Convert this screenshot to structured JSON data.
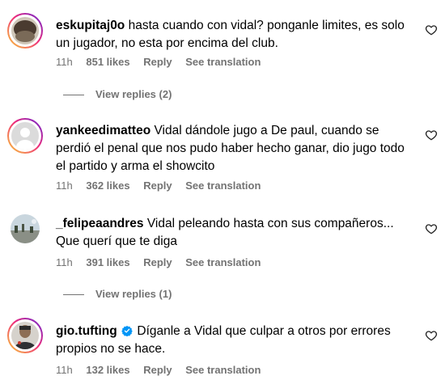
{
  "comments": [
    {
      "username": "eskupitaj0o",
      "text": "hasta cuando con vidal? ponganle limites, es solo un jugador, no esta por encima del club.",
      "time": "11h",
      "likes": "851 likes",
      "reply": "Reply",
      "translation": "See translation",
      "view_replies": "View replies (2)"
    },
    {
      "username": "yankeedimatteo",
      "text": "Vidal dándole jugo a De paul, cuando se perdió el penal que nos pudo haber hecho ganar, dio jugo todo el partido y arma el showcito",
      "time": "11h",
      "likes": "362 likes",
      "reply": "Reply",
      "translation": "See translation"
    },
    {
      "username": "_felipeaandres",
      "text": "Vidal peleando hasta con sus compañeros... Que querí que te diga",
      "time": "11h",
      "likes": "391 likes",
      "reply": "Reply",
      "translation": "See translation",
      "view_replies": "View replies (1)"
    },
    {
      "username": "gio.tufting",
      "text": "Díganle a Vidal que culpar a otros por errores propios no se hace.",
      "time": "11h",
      "likes": "132 likes",
      "reply": "Reply",
      "translation": "See translation"
    }
  ],
  "icons": {
    "like": "heart-outline-icon",
    "verified": "verified-badge-icon"
  },
  "colors": {
    "secondary_text": "#737373",
    "verified_blue": "#0095f6"
  }
}
